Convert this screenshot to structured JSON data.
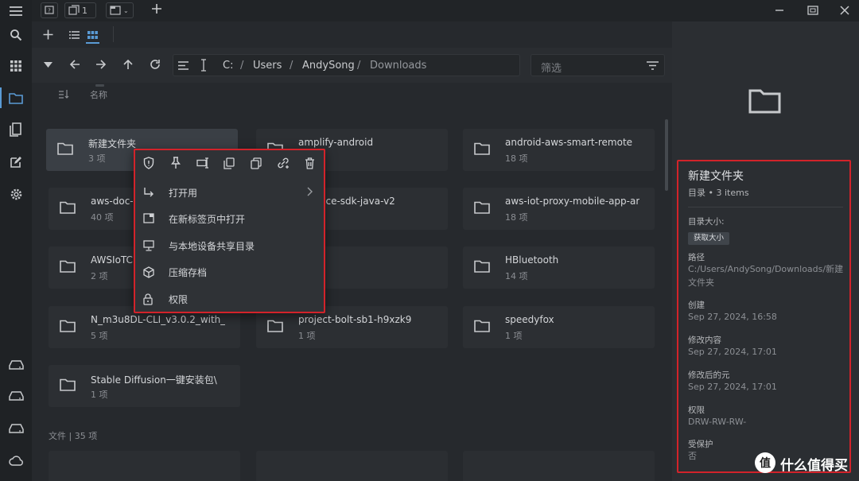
{
  "titlebar": {
    "tab_count": "1"
  },
  "nav": {
    "path": [
      "C:",
      "Users",
      "AndySong",
      "Downloads"
    ],
    "separator": "/",
    "filter_placeholder": "筛选"
  },
  "column_header": {
    "name_label": "名称"
  },
  "tiles": [
    {
      "name": "新建文件夹",
      "sub": "3 项"
    },
    {
      "name": "amplify-android",
      "sub": ""
    },
    {
      "name": "android-aws-smart-remote",
      "sub": "18 项"
    },
    {
      "name": "aws-doc-s",
      "sub": "40 项"
    },
    {
      "name": "t-device-sdk-java-v2",
      "sub": ""
    },
    {
      "name": "aws-iot-proxy-mobile-app-ar",
      "sub": "18 项"
    },
    {
      "name": "AWSIoTC",
      "sub": "2 项"
    },
    {
      "name": "",
      "sub": ""
    },
    {
      "name": "HBluetooth",
      "sub": "14 项"
    },
    {
      "name": "N_m3u8DL-CLI_v3.0.2_with_",
      "sub": "5 项"
    },
    {
      "name": "project-bolt-sb1-h9xzk9",
      "sub": "1 项"
    },
    {
      "name": "speedyfox",
      "sub": "1 项"
    },
    {
      "name": "Stable Diffusion一键安装包\\",
      "sub": "1 项"
    }
  ],
  "section_label": "文件 | 35 项",
  "context_menu": {
    "quick_icons": [
      "shield-icon",
      "pin-icon",
      "rename-icon",
      "copy-icon",
      "duplicate-icon",
      "link-icon",
      "trash-icon"
    ],
    "items": [
      {
        "label": "打开用",
        "icon": "open-with-icon",
        "has_submenu": true
      },
      {
        "label": "在新标签页中打开",
        "icon": "new-tab-icon",
        "has_submenu": false
      },
      {
        "label": "与本地设备共享目录",
        "icon": "share-device-icon",
        "has_submenu": false
      },
      {
        "label": "压缩存档",
        "icon": "archive-icon",
        "has_submenu": false
      },
      {
        "label": "权限",
        "icon": "lock-icon",
        "has_submenu": false
      }
    ]
  },
  "details": {
    "title": "新建文件夹",
    "subtitle": "目录 • 3 items",
    "size_label": "目录大小:",
    "size_button": "获取大小",
    "path_label": "路径",
    "path_value": "C:/Users/AndySong/Downloads/新建文件夹",
    "created_label": "创建",
    "created_value": "Sep 27, 2024, 16:58",
    "modified_label": "修改内容",
    "modified_value": "Sep 27, 2024, 17:01",
    "meta_modified_label": "修改后的元",
    "meta_modified_value": "Sep 27, 2024, 17:01",
    "permissions_label": "权限",
    "permissions_value": "DRW-RW-RW-",
    "protected_label": "受保护",
    "protected_value": "否"
  },
  "watermark": {
    "text": "什么值得买",
    "logo_char": "值"
  },
  "colors": {
    "accent": "#5a9bd5",
    "highlight_border": "#d2232a",
    "tile_bg": "#2c2f33"
  }
}
